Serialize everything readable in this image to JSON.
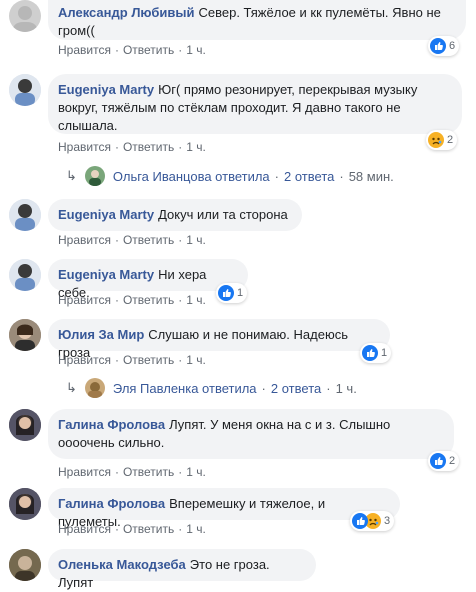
{
  "comments": [
    {
      "author": "Александр Любивый",
      "text": "Север. Тяжёлое и кк пулемёты. Явно не гром((",
      "like": "Нравится",
      "reply": "Ответить",
      "time": "1 ч.",
      "reactions": "6"
    },
    {
      "author": "Eugeniya Marty",
      "text": "Юг( прямо резонирует, перекрывая музыку вокруг, тяжёлым по стёклам проходит. Я давно такого не слышала.",
      "like": "Нравится",
      "reply": "Ответить",
      "time": "1 ч.",
      "reactions": "2"
    },
    {
      "author": "Eugeniya Marty",
      "text": "Докуч или та сторона .",
      "like": "Нравится",
      "reply": "Ответить",
      "time": "1 ч."
    },
    {
      "author": "Eugeniya Marty",
      "text": "Ни хера себе.",
      "like": "Нравится",
      "reply": "Ответить",
      "time": "1 ч.",
      "reactions": "1"
    },
    {
      "author": "Юлия За Мир",
      "text": "Слушаю и не понимаю. Надеюсь гроза",
      "like": "Нравится",
      "reply": "Ответить",
      "time": "1 ч.",
      "reactions": "1"
    },
    {
      "author": "Галина Фролова",
      "text": "Лупят. У меня окна на с и з. Слышно оооочень сильно.",
      "like": "Нравится",
      "reply": "Ответить",
      "time": "1 ч.",
      "reactions": "2"
    },
    {
      "author": "Галина Фролова",
      "text": "Вперемешку и тяжелое, и пулеметы.",
      "like": "Нравится",
      "reply": "Ответить",
      "time": "1 ч.",
      "reactions": "3"
    },
    {
      "author": "Оленька Макодзеба",
      "text": "Это не гроза. Лупят"
    }
  ],
  "replies": [
    {
      "text": "Ольга Иванцова ответила",
      "dot": "·",
      "count": "2 ответа",
      "time": "58 мин."
    },
    {
      "text": "Эля Павленка ответила",
      "dot": "·",
      "count": "2 ответа",
      "time": "1 ч."
    }
  ],
  "colors": {
    "link": "#385898",
    "bubble": "#f2f3f5",
    "like": "#1877f2",
    "sad": "#f7b125"
  },
  "icons": {
    "like": "thumbs-up-icon",
    "sad": "sad-face-icon",
    "reply_arrow": "reply-arrow-icon"
  }
}
